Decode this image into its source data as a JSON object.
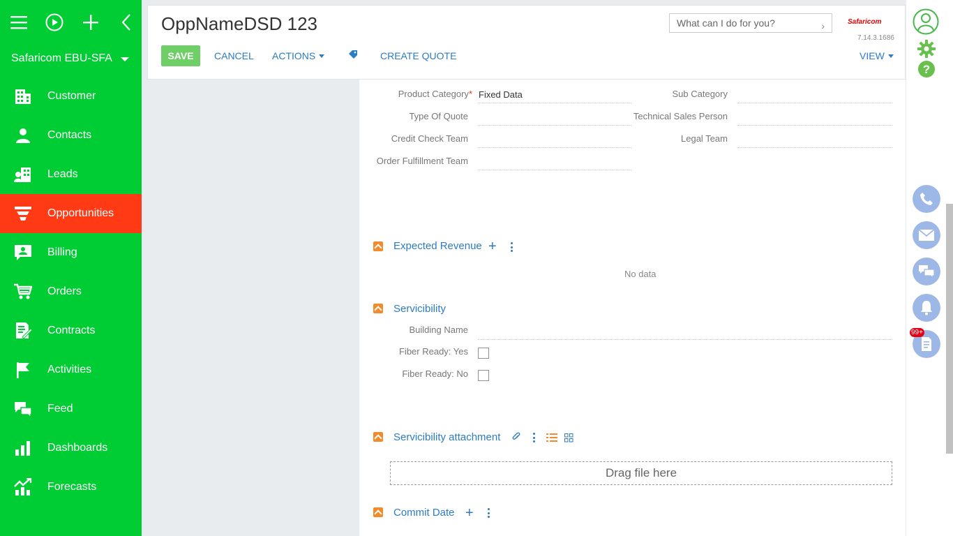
{
  "sidebar": {
    "workspace": "Safaricom EBU-SFA",
    "items": [
      {
        "label": "Customer",
        "icon": "building-icon"
      },
      {
        "label": "Contacts",
        "icon": "person-icon"
      },
      {
        "label": "Leads",
        "icon": "leads-icon"
      },
      {
        "label": "Opportunities",
        "icon": "funnel-icon",
        "active": true
      },
      {
        "label": "Billing",
        "icon": "billing-icon"
      },
      {
        "label": "Orders",
        "icon": "cart-icon"
      },
      {
        "label": "Contracts",
        "icon": "contract-icon"
      },
      {
        "label": "Activities",
        "icon": "flag-icon"
      },
      {
        "label": "Feed",
        "icon": "chat-icon"
      },
      {
        "label": "Dashboards",
        "icon": "bar-chart-icon"
      },
      {
        "label": "Forecasts",
        "icon": "forecast-icon"
      }
    ],
    "colors": {
      "background": "#00cc33",
      "active": "#ff3a14"
    }
  },
  "header": {
    "title": "OppNameDSD 123",
    "save_label": "SAVE",
    "cancel_label": "CANCEL",
    "actions_label": "ACTIONS",
    "create_quote_label": "CREATE QUOTE",
    "view_label": "VIEW",
    "search_placeholder": "What can I do for you?",
    "logo_text": "Safaricom",
    "version": "7.14.3.1686"
  },
  "fields": {
    "product_category": {
      "label": "Product Category",
      "value": "Fixed Data",
      "required": "*"
    },
    "sub_category": {
      "label": "Sub Category",
      "value": ""
    },
    "type_of_quote": {
      "label": "Type Of Quote",
      "value": ""
    },
    "technical_sales_person": {
      "label": "Technical Sales Person",
      "value": ""
    },
    "credit_check_team": {
      "label": "Credit Check Team",
      "value": ""
    },
    "legal_team": {
      "label": "Legal Team",
      "value": ""
    },
    "order_fulfillment_team": {
      "label": "Order Fulfillment Team",
      "value": ""
    }
  },
  "sections": {
    "expected_revenue": {
      "title": "Expected Revenue",
      "empty_text": "No data"
    },
    "servicibility": {
      "title": "Servicibility",
      "building_name_label": "Building Name",
      "fiber_yes_label": "Fiber Ready: Yes",
      "fiber_no_label": "Fiber Ready: No",
      "fiber_yes_checked": false,
      "fiber_no_checked": false
    },
    "servicibility_attachment": {
      "title": "Servicibility attachment",
      "drop_text": "Drag file here"
    },
    "commit_date": {
      "title": "Commit Date"
    }
  },
  "rightbar": {
    "badge": "99+",
    "icons": [
      "avatar-icon",
      "gear-icon",
      "help-icon",
      "phone-icon",
      "mail-icon",
      "chat-icon",
      "bell-icon",
      "document-icon"
    ]
  }
}
